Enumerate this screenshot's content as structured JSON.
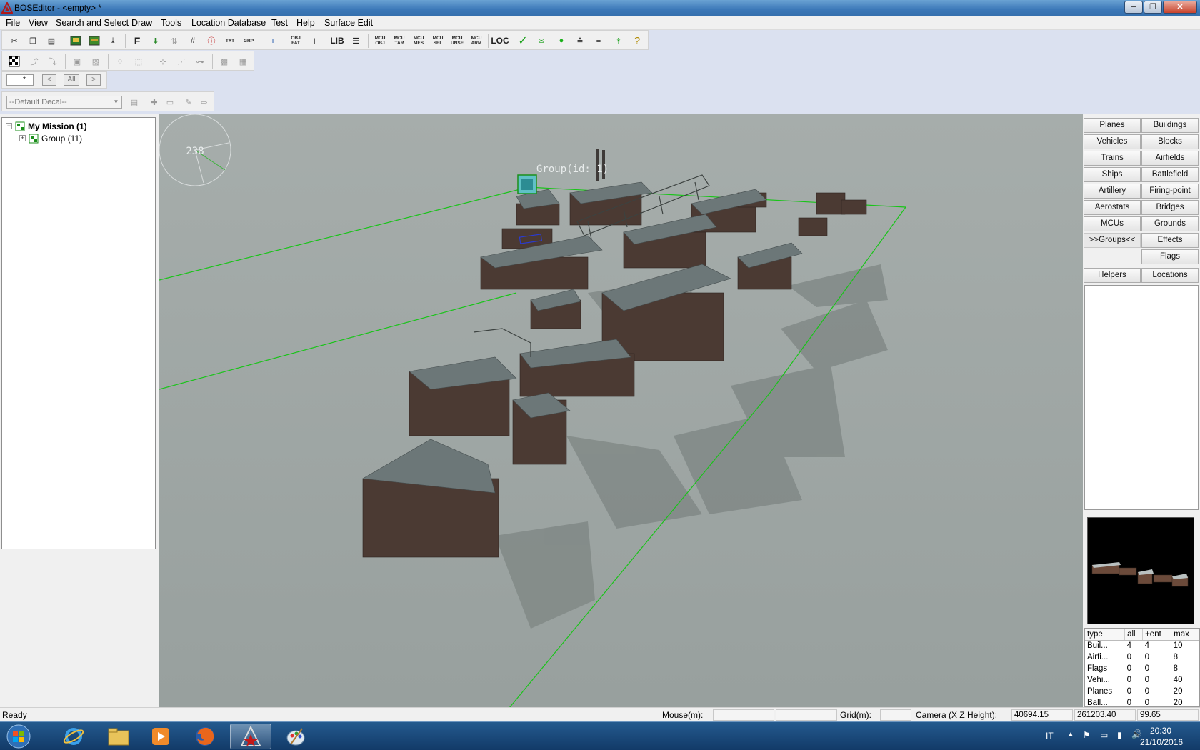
{
  "window": {
    "title": "BOSEditor - <empty> *",
    "controls": {
      "minimize": "─",
      "maximize": "❐",
      "close": "✕"
    }
  },
  "menu": [
    "File",
    "View",
    "Search and Select",
    "Draw",
    "Tools",
    "Location Database",
    "Test",
    "Help",
    "Surface Edit"
  ],
  "toolbar": {
    "text_buttons": {
      "F": "F",
      "txt": "TXT",
      "grp": "GRP",
      "objfat": "OBJ FAT",
      "lib": "LIB",
      "mcu_obj": "MCU OBJ",
      "mcu_tar": "MCU TAR",
      "mcu_mes": "MCU MES",
      "mcu_sel": "MCU SEL",
      "mcu_unse": "MCU UNSE",
      "mcu_arm": "MCU ARM",
      "loc": "LOC"
    },
    "filter": {
      "value": "*",
      "prev": "<",
      "all": "All",
      "next": ">"
    },
    "decal": {
      "value": "--Default Decal--"
    }
  },
  "tree": {
    "root": {
      "expander": "−",
      "label": "My Mission (1)"
    },
    "child": {
      "expander": "+",
      "label": "Group (11)"
    }
  },
  "viewport": {
    "compass_value": "238",
    "group_label": "Group(id: 1)"
  },
  "categories": {
    "left": [
      "Planes",
      "Vehicles",
      "Trains",
      "Ships",
      "Artillery",
      "Aerostats",
      "MCUs",
      ">>Groups<<"
    ],
    "right": [
      "Buildings",
      "Blocks",
      "Airfields",
      "Battlefield",
      "Firing-point",
      "Bridges",
      "Grounds",
      "Effects",
      "Flags"
    ],
    "bottom": [
      "Helpers",
      "Locations"
    ],
    "active": ">>Groups<<"
  },
  "stats": {
    "headers": [
      "type",
      "all",
      "+ent",
      "max"
    ],
    "rows": [
      [
        "Buil...",
        "4",
        "4",
        "10"
      ],
      [
        "Airfi...",
        "0",
        "0",
        "8"
      ],
      [
        "Flags",
        "0",
        "0",
        "8"
      ],
      [
        "Vehi...",
        "0",
        "0",
        "40"
      ],
      [
        "Planes",
        "0",
        "0",
        "20"
      ],
      [
        "Ball...",
        "0",
        "0",
        "20"
      ]
    ]
  },
  "statusbar": {
    "status": "Ready",
    "mouse_label": "Mouse(m):",
    "grid_label": "Grid(m):",
    "camera_label": "Camera (X Z Height):",
    "camera_x": "40694.15",
    "camera_z": "261203.40",
    "camera_h": "99.65"
  },
  "taskbar": {
    "lang": "IT",
    "time": "20:30",
    "date": "21/10/2016"
  },
  "colors": {
    "selection_green": "#19c419",
    "ground": "#9aa2a0",
    "active_task_bg": "#4a7db0"
  }
}
